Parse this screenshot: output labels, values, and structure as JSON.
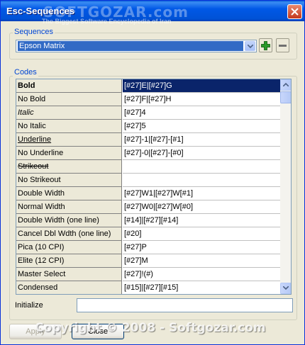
{
  "window": {
    "title": "Esc-Sequences",
    "watermark_logo": "SOFTGOZAR.com",
    "watermark_sub": "The Biggest Software Encyclopedia of Iran",
    "copyright": "Copyright © 2008 - Softgozar.com"
  },
  "sequences": {
    "group_label": "Sequences",
    "selected": "Epson Matrix"
  },
  "codes": {
    "group_label": "Codes",
    "rows": [
      {
        "name": "Bold",
        "code": "[#27]E|[#27]G",
        "style": "bold",
        "selected": true
      },
      {
        "name": "No Bold",
        "code": "[#27]F|[#27]H",
        "style": "normal"
      },
      {
        "name": "Italic",
        "code": "[#27]4",
        "style": "italic"
      },
      {
        "name": "No Italic",
        "code": "[#27]5",
        "style": "normal"
      },
      {
        "name": "Underline",
        "code": "[#27]-1|[#27]-[#1]",
        "style": "underline"
      },
      {
        "name": "No Underline",
        "code": "[#27]-0|[#27]-[#0]",
        "style": "normal"
      },
      {
        "name": "Strikeout",
        "code": "",
        "style": "strike"
      },
      {
        "name": "No Strikeout",
        "code": "",
        "style": "normal"
      },
      {
        "name": "Double Width",
        "code": "[#27]W1|[#27]W[#1]",
        "style": "normal"
      },
      {
        "name": "Normal Width",
        "code": "[#27]W0|[#27]W[#0]",
        "style": "normal"
      },
      {
        "name": "Double Width (one line)",
        "code": "[#14]|[#27][#14]",
        "style": "normal"
      },
      {
        "name": "Cancel Dbl Wdth (one line)",
        "code": "[#20]",
        "style": "normal"
      },
      {
        "name": "Pica (10 CPI)",
        "code": "[#27]P",
        "style": "normal"
      },
      {
        "name": "Elite (12 CPI)",
        "code": "[#27]M",
        "style": "normal"
      },
      {
        "name": "Master Select",
        "code": "[#27]!(#)",
        "style": "normal"
      },
      {
        "name": "Condensed",
        "code": "[#15]|[#27][#15]",
        "style": "normal"
      }
    ]
  },
  "initialize": {
    "label": "Initialize",
    "value": ""
  },
  "buttons": {
    "apply": "Apply",
    "close": "Close"
  },
  "colors": {
    "title_bar": "#0058e6",
    "selection": "#0a246a",
    "group_label": "#0046d5",
    "add_icon": "#2a9a2a"
  }
}
